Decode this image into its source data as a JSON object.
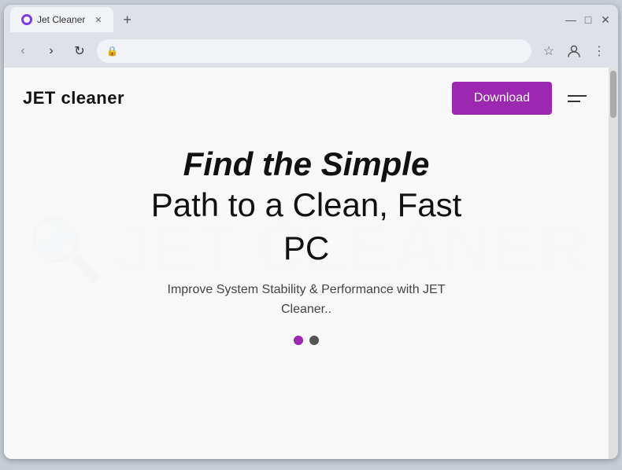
{
  "browser": {
    "tab_title": "Jet Cleaner",
    "new_tab_symbol": "+",
    "window_controls": {
      "minimize": "—",
      "maximize": "□",
      "close": "✕"
    },
    "nav": {
      "back": "‹",
      "forward": "›",
      "refresh": "↻"
    },
    "url": "",
    "address_icons": {
      "star": "☆",
      "profile": "👤",
      "menu": "⋮"
    }
  },
  "site": {
    "logo": "JET cleaner",
    "download_button": "Download",
    "hero": {
      "title_bold": "Find the Simple",
      "title_normal_1": "Path to a Clean, Fast",
      "title_normal_2": "PC",
      "subtitle": "Improve System Stability & Performance with JET Cleaner..",
      "watermark": "JET CLEANER"
    },
    "carousel": {
      "dots": [
        {
          "id": 1,
          "active": true
        },
        {
          "id": 2,
          "active": false
        }
      ]
    }
  }
}
